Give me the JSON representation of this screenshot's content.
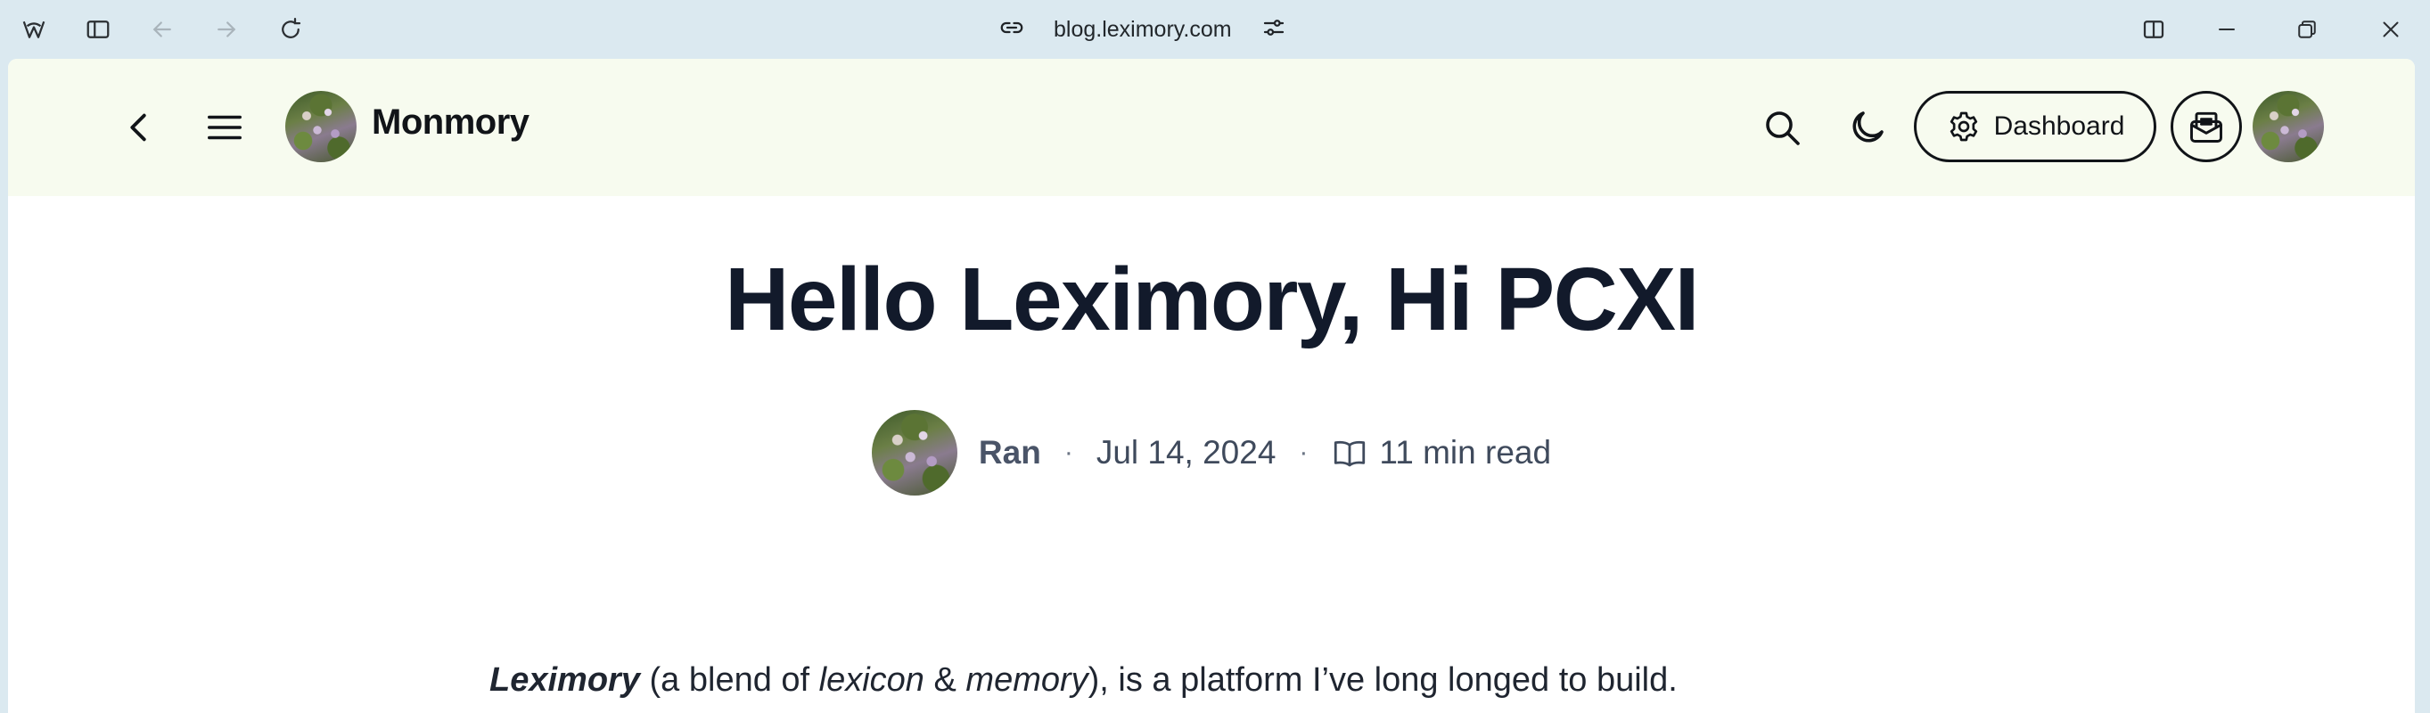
{
  "browser": {
    "url": "blog.leximory.com",
    "icons": {
      "app": "browser-logo-icon",
      "sidebar": "sidebar-toggle-icon",
      "back": "back-arrow-icon",
      "forward": "forward-arrow-icon",
      "reload": "reload-icon",
      "link": "link-icon",
      "site_settings": "sliders-icon",
      "split": "split-view-icon",
      "minimize": "minimize-icon",
      "restore": "restore-icon",
      "close": "close-icon"
    }
  },
  "header": {
    "brand": "Monmory",
    "dashboard_label": "Dashboard",
    "background": "#f7fbef",
    "icons": {
      "back": "chevron-left-icon",
      "menu": "hamburger-menu-icon",
      "search": "search-icon",
      "theme": "moon-icon",
      "dashboard": "gear-icon",
      "inbox": "mail-inbox-icon"
    }
  },
  "post": {
    "title": "Hello Leximory, Hi PCXI",
    "author": "Ran",
    "date": "Jul 14, 2024",
    "separator": "·",
    "read_time": "11 min read",
    "intro": {
      "name": "Leximory",
      "part1": " (a blend of ",
      "word1": "lexicon",
      "part2": " & ",
      "word2": "memory",
      "part3": "), is a platform I’ve long longed to build."
    }
  },
  "colors": {
    "chrome": "#dbe9f0",
    "title": "#121a2b",
    "meta": "#3f4a5c",
    "body_text": "#1f2530"
  }
}
